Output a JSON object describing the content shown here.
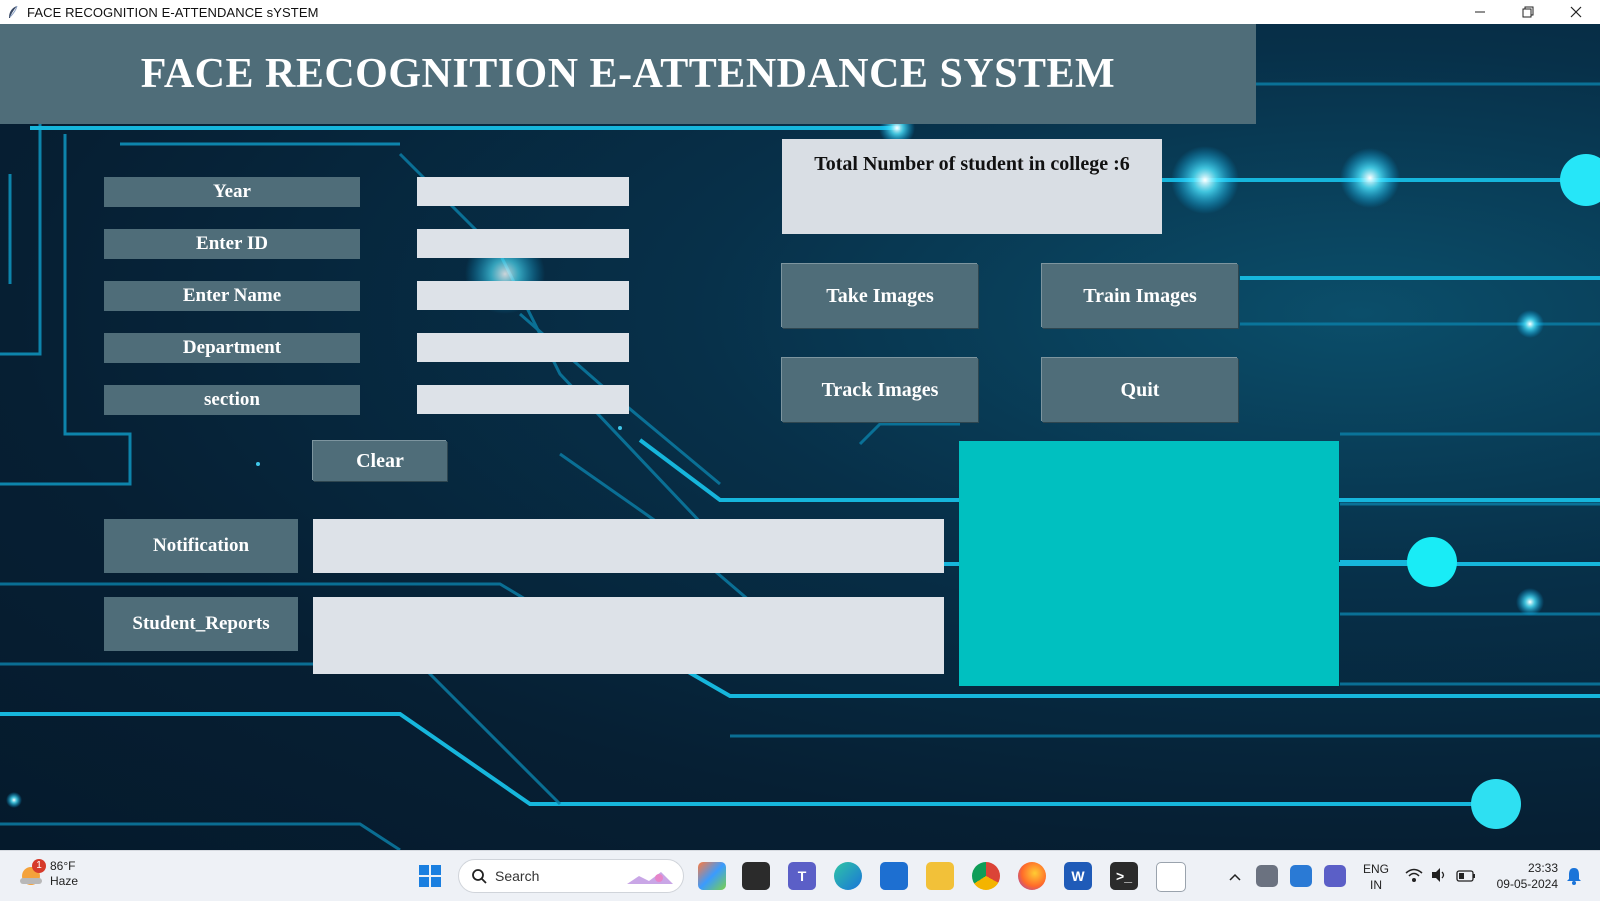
{
  "window": {
    "title": "FACE RECOGNITION E-ATTENDANCE sYSTEM"
  },
  "header": {
    "title": "FACE RECOGNITION E-ATTENDANCE SYSTEM"
  },
  "form": {
    "year_label": "Year",
    "id_label": "Enter ID",
    "name_label": "Enter Name",
    "department_label": "Department",
    "section_label": "section",
    "year_value": "",
    "id_value": "",
    "name_value": "",
    "department_value": "",
    "section_value": "",
    "clear_label": "Clear"
  },
  "notification": {
    "label": "Notification",
    "value": ""
  },
  "reports": {
    "label": "Student_Reports",
    "value": ""
  },
  "total": {
    "text": "Total Number of student in college :6"
  },
  "actions": {
    "take_images": "Take Images",
    "train_images": "Train Images",
    "track_images": "Track Images",
    "quit": "Quit"
  },
  "colors": {
    "panel": "#4f6d79",
    "field": "#dde2e8",
    "cyan_panel": "#00c0c0"
  },
  "taskbar": {
    "weather_temp": "86°F",
    "weather_cond": "Haze",
    "weather_badge": "1",
    "search_placeholder": "Search",
    "lang_line1": "ENG",
    "lang_line2": "IN",
    "time": "23:33",
    "date": "09-05-2024"
  }
}
